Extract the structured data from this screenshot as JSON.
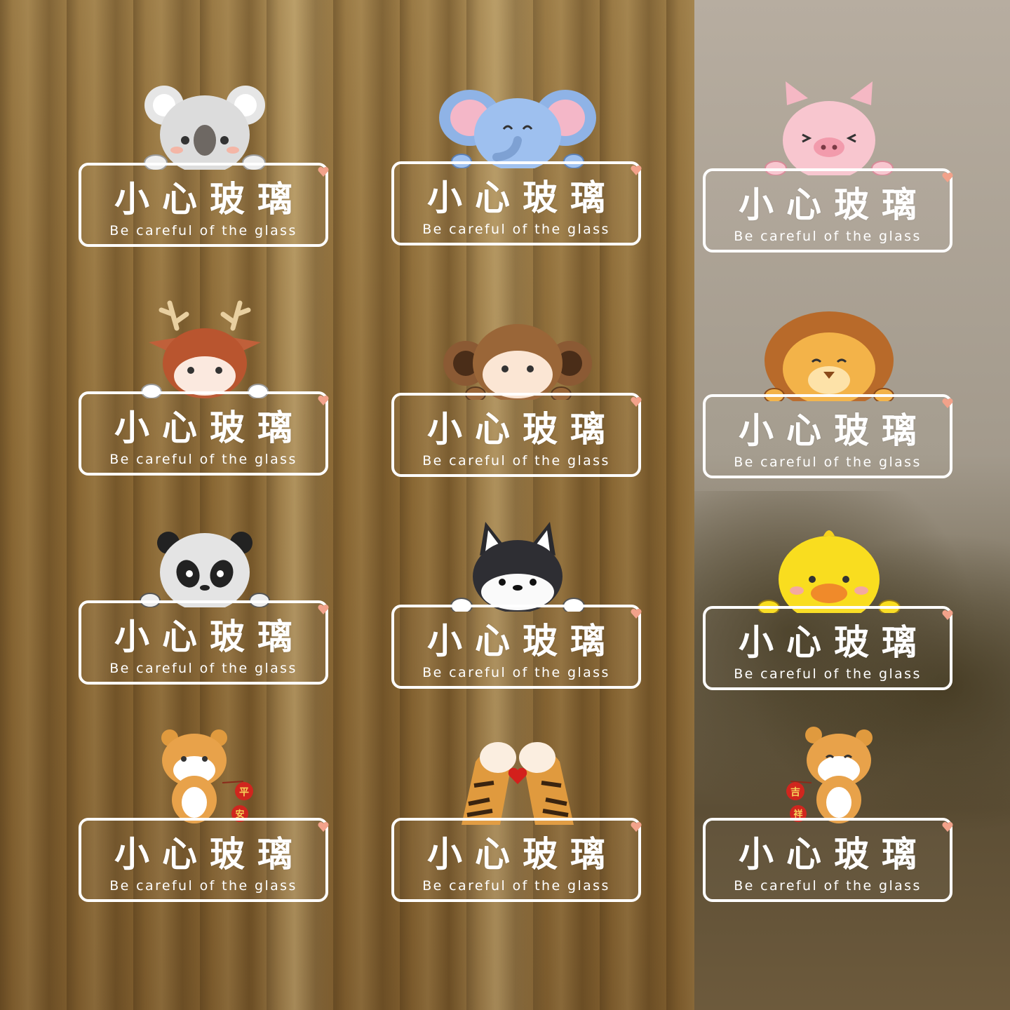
{
  "sign": {
    "title": "小心玻璃",
    "subtitle": "Be careful of the glass"
  },
  "stickers": [
    {
      "animal": "koala"
    },
    {
      "animal": "elephant"
    },
    {
      "animal": "pig"
    },
    {
      "animal": "deer"
    },
    {
      "animal": "monkey"
    },
    {
      "animal": "lion"
    },
    {
      "animal": "panda"
    },
    {
      "animal": "shiba-dog"
    },
    {
      "animal": "duck"
    },
    {
      "animal": "tiger",
      "lantern_text": [
        "平",
        "安"
      ]
    },
    {
      "animal": "tiger-paws-heart"
    },
    {
      "animal": "tiger",
      "lantern_text": [
        "吉",
        "祥"
      ]
    }
  ],
  "colors": {
    "plate_border": "#ffffff",
    "heart": "#f2a28a"
  }
}
